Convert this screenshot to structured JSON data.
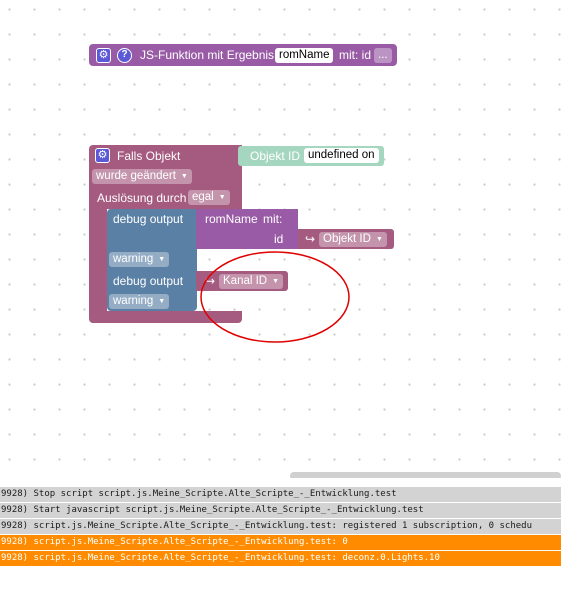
{
  "function_block": {
    "label": "JS-Funktion mit Ergebnis",
    "param_name": "romName",
    "mit_label": "mit: id",
    "more": "...",
    "help_glyph": "?",
    "gear_icon": "gear-icon",
    "color": "#995ba5"
  },
  "trigger_block": {
    "title": "Falls Objekt",
    "object_label": "Objekt ID",
    "object_value": "undefined on",
    "condition": "wurde geändert",
    "trigger_label": "Auslösung durch",
    "trigger_value": "egal",
    "color": "#a55b80"
  },
  "debug1": {
    "label": "debug output",
    "level": "warning",
    "call_name": "romName",
    "call_mit": "mit:",
    "call_param": "id",
    "arg_value": "Objekt ID",
    "color": "#5b80a5"
  },
  "debug2": {
    "label": "debug output",
    "level": "warning",
    "arg_value": "Kanal ID"
  },
  "on_arrow": "↪",
  "log": [
    {
      "text": "9928) Stop script script.js.Meine_Scripte.Alte_Scripte_-_Entwicklung.test",
      "level": "info"
    },
    {
      "text": "9928) Start javascript script.js.Meine_Scripte.Alte_Scripte_-_Entwicklung.test",
      "level": "info"
    },
    {
      "text": "9928) script.js.Meine_Scripte.Alte_Scripte_-_Entwicklung.test: registered 1 subscription, 0 schedu",
      "level": "info"
    },
    {
      "text": "9928) script.js.Meine_Scripte.Alte_Scripte_-_Entwicklung.test: 0",
      "level": "warn"
    },
    {
      "text": "9928) script.js.Meine_Scripte.Alte_Scripte_-_Entwicklung.test: deconz.0.Lights.10",
      "level": "warn"
    }
  ],
  "colors": {
    "warn_bg": "#ff8c00",
    "info_bg": "#d3d3d3",
    "annotation": "#e00000"
  }
}
